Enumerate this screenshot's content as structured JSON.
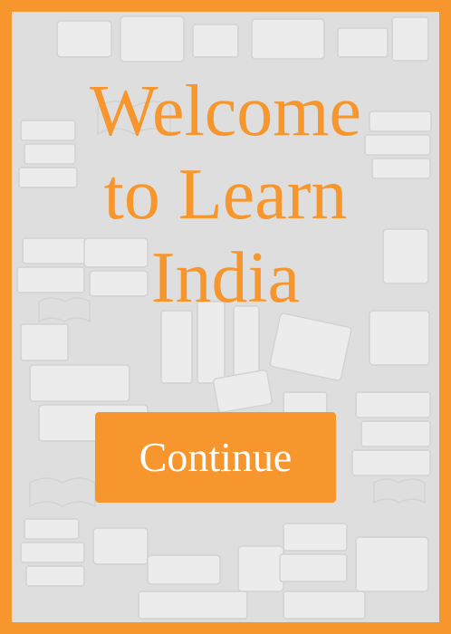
{
  "welcome": {
    "title_lines": [
      "Welcome",
      "to Learn",
      "India"
    ]
  },
  "actions": {
    "continue_label": "Continue"
  },
  "colors": {
    "accent": "#F7962D",
    "background": "#DEDEDE",
    "pattern": "#EDEDED",
    "button_text": "#FFFFFF"
  },
  "background_art": {
    "icon": "books-pattern-icon"
  }
}
